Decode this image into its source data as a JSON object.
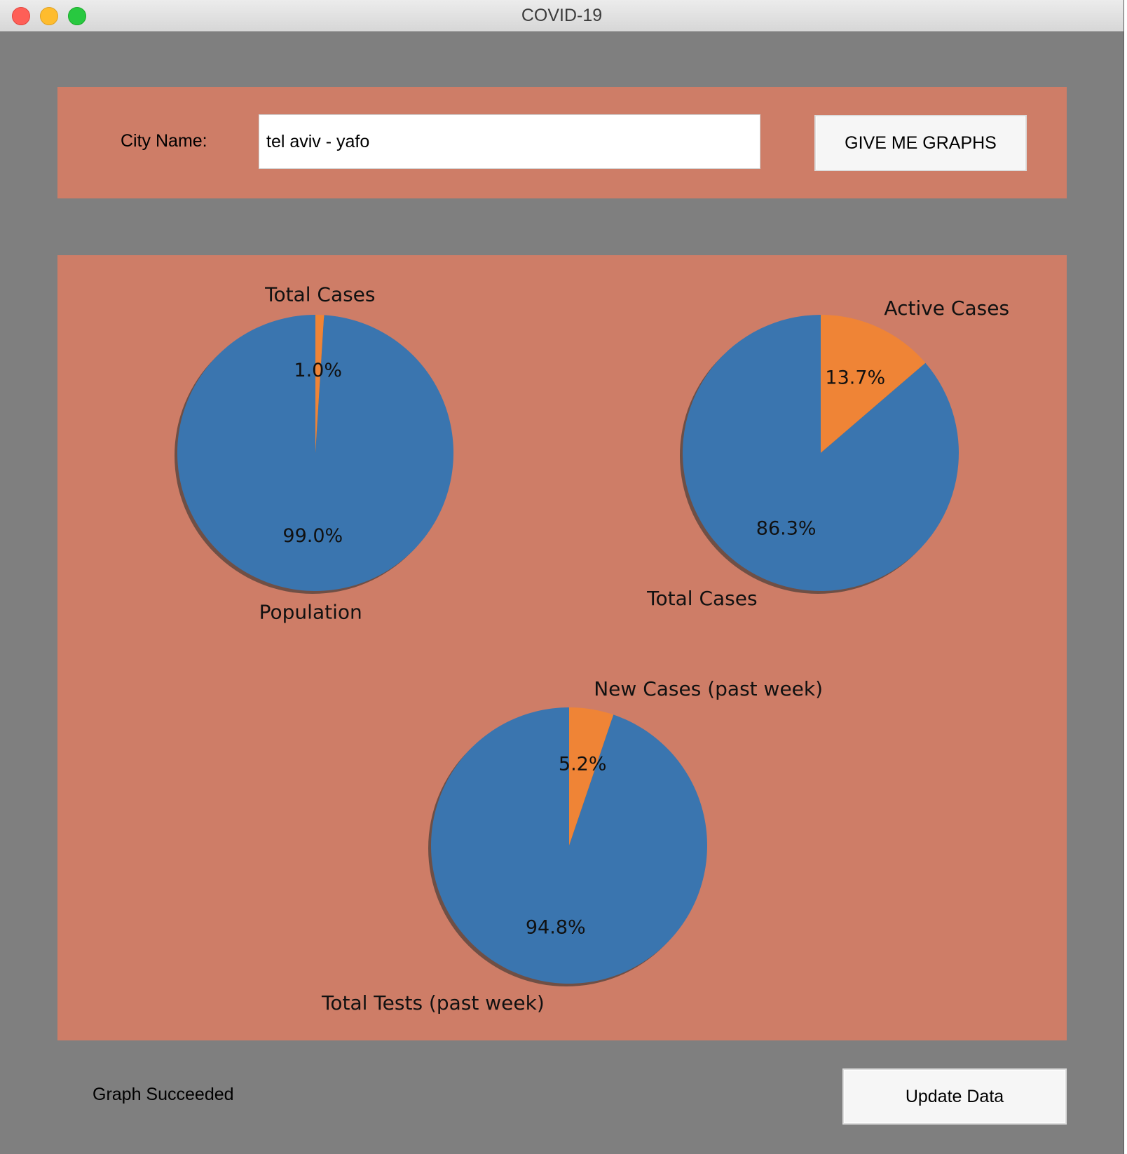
{
  "window": {
    "title": "COVID-19"
  },
  "form": {
    "city_label": "City Name:",
    "city_value": "tel aviv - yafo",
    "graph_button": "GIVE ME GRAPHS"
  },
  "footer": {
    "status": "Graph Succeeded",
    "update_button": "Update Data"
  },
  "colors": {
    "panel": "#ce7d67",
    "background": "#7f7f7f",
    "slice_blue": "#3a75af",
    "slice_orange": "#ef8436"
  },
  "chart_data": [
    {
      "type": "pie",
      "labels": [
        "Population",
        "Total Cases"
      ],
      "values": [
        99.0,
        1.0
      ],
      "percent_labels": [
        "99.0%",
        "1.0%"
      ],
      "colors": [
        "#3a75af",
        "#ef8436"
      ],
      "shadow": true
    },
    {
      "type": "pie",
      "labels": [
        "Total Cases",
        "Active Cases"
      ],
      "values": [
        86.3,
        13.7
      ],
      "percent_labels": [
        "86.3%",
        "13.7%"
      ],
      "colors": [
        "#3a75af",
        "#ef8436"
      ],
      "shadow": true
    },
    {
      "type": "pie",
      "labels": [
        "Total Tests (past week)",
        "New Cases (past week)"
      ],
      "values": [
        94.8,
        5.2
      ],
      "percent_labels": [
        "94.8%",
        "5.2%"
      ],
      "colors": [
        "#3a75af",
        "#ef8436"
      ],
      "shadow": true
    }
  ]
}
